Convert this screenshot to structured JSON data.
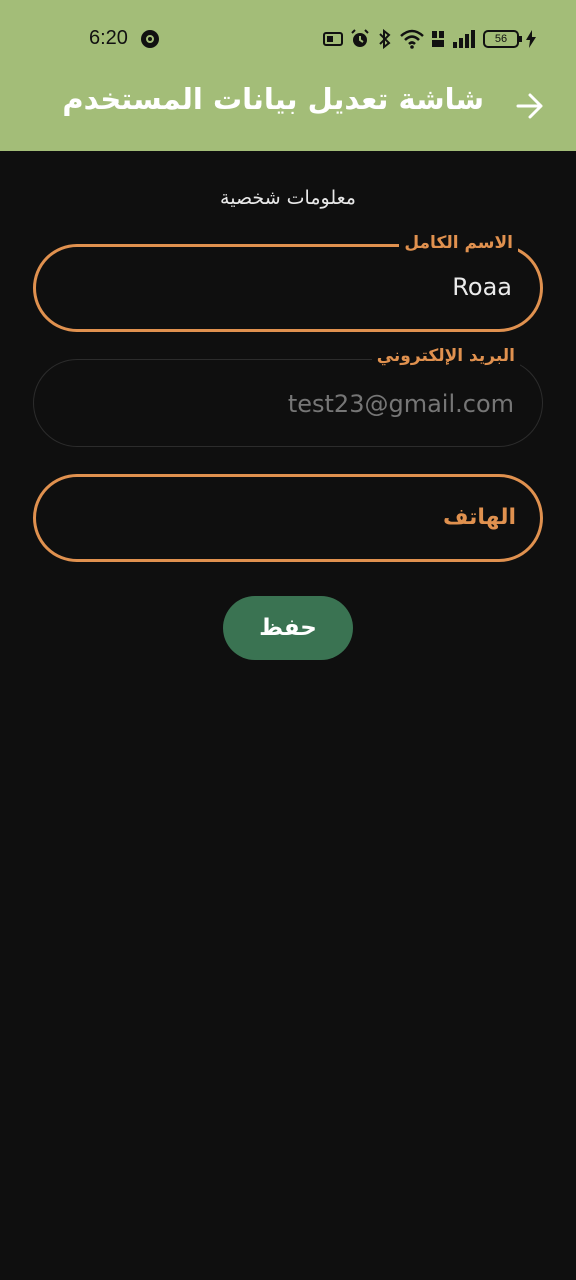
{
  "status_bar": {
    "time": "6:20",
    "battery": "56"
  },
  "header": {
    "title": "شاشة تعديل بيانات المستخدم",
    "back_icon": "arrow-right-icon",
    "background": "#a3bd78"
  },
  "form": {
    "section_title": "معلومات شخصية",
    "fields": [
      {
        "label": "الاسم الكامل",
        "value": "Roaa"
      },
      {
        "label": "البريد الإلكتروني",
        "value": "test23@gmail.com"
      },
      {
        "placeholder": "الهاتف"
      }
    ],
    "save_label": "حفظ"
  },
  "colors": {
    "accent": "#e0914f",
    "button": "#3a7352",
    "background": "#0f0f0f"
  }
}
